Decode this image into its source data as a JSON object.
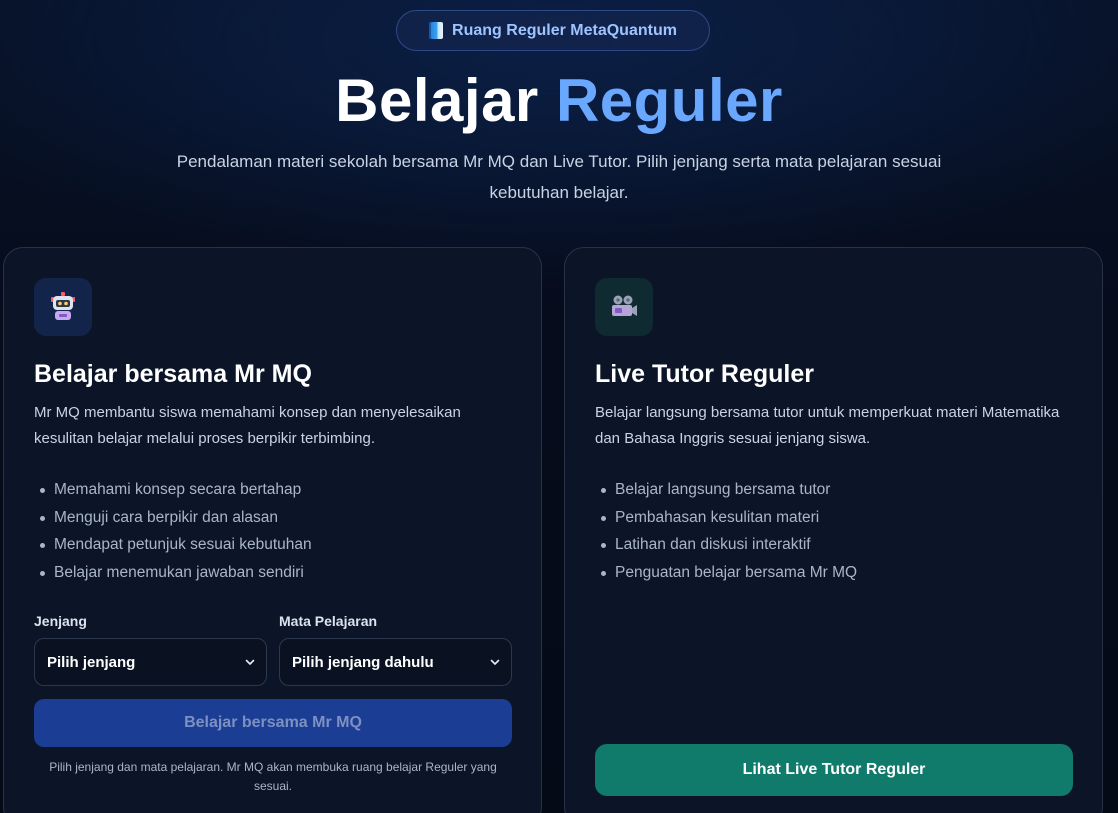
{
  "header": {
    "badge_icon": "book-icon",
    "badge_label": "Ruang Reguler MetaQuantum",
    "title_plain": "Belajar ",
    "title_accent": "Reguler",
    "subtitle": "Pendalaman materi sekolah bersama Mr MQ dan Live Tutor. Pilih jenjang serta mata pelajaran sesuai kebutuhan belajar."
  },
  "mrmq_card": {
    "icon": "robot-icon",
    "title": "Belajar bersama Mr MQ",
    "description": "Mr MQ membantu siswa memahami konsep dan menyelesaikan kesulitan belajar melalui proses berpikir terbimbing.",
    "features": [
      "Memahami konsep secara bertahap",
      "Menguji cara berpikir dan alasan",
      "Mendapat petunjuk sesuai kebutuhan",
      "Belajar menemukan jawaban sendiri"
    ],
    "jenjang_label": "Jenjang",
    "jenjang_value": "Pilih jenjang",
    "mapel_label": "Mata Pelajaran",
    "mapel_value": "Pilih jenjang dahulu",
    "button_label": "Belajar bersama Mr MQ",
    "helper_text": "Pilih jenjang dan mata pelajaran. Mr MQ akan membuka ruang belajar Reguler yang sesuai."
  },
  "live_card": {
    "icon": "movie-camera-icon",
    "title": "Live Tutor Reguler",
    "description": "Belajar langsung bersama tutor untuk memperkuat materi Matematika dan Bahasa Inggris sesuai jenjang siswa.",
    "features": [
      "Belajar langsung bersama tutor",
      "Pembahasan kesulitan materi",
      "Latihan dan diskusi interaktif",
      "Penguatan belajar bersama Mr MQ"
    ],
    "button_label": "Lihat Live Tutor Reguler"
  },
  "colors": {
    "accent_blue": "#6aa8ff",
    "primary_button": "#1b3d93",
    "teal_button": "#107a6b",
    "card_bg": "#0c1527"
  }
}
